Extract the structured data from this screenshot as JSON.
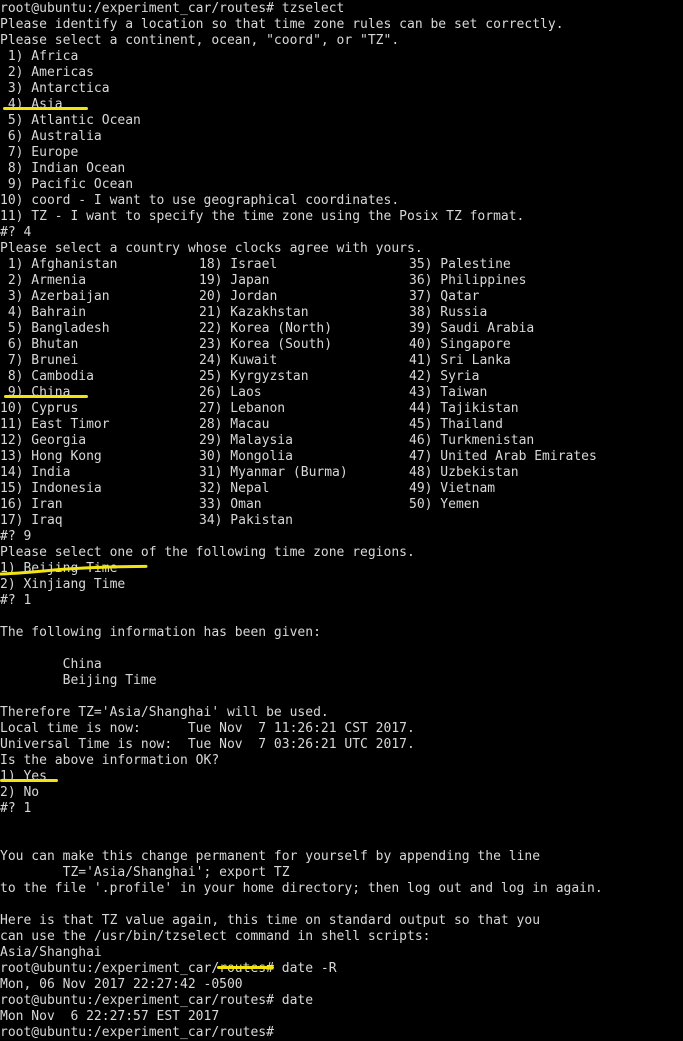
{
  "terminal": {
    "background_color": "#000000",
    "text_color": "#d8d8d8",
    "annotation_color": "#f2e313",
    "prompt": "root@ubuntu:/experiment_car/routes#",
    "command": "tzselect"
  },
  "lines": {
    "l01": "root@ubuntu:/experiment_car/routes# tzselect",
    "l02": "Please identify a location so that time zone rules can be set correctly.",
    "l03": "Please select a continent, ocean, \"coord\", or \"TZ\".",
    "l04": " 1) Africa",
    "l05": " 2) Americas",
    "l06": " 3) Antarctica",
    "l07": " 4) Asia",
    "l08": " 5) Atlantic Ocean",
    "l09": " 6) Australia",
    "l10": " 7) Europe",
    "l11": " 8) Indian Ocean",
    "l12": " 9) Pacific Ocean",
    "l13": "10) coord - I want to use geographical coordinates.",
    "l14": "11) TZ - I want to specify the time zone using the Posix TZ format.",
    "l15": "#? 4",
    "l16": "Please select a country whose clocks agree with yours.",
    "l17": "#? 9",
    "l18": "Please select one of the following time zone regions.",
    "l19": "1) Beijing Time",
    "l20": "2) Xinjiang Time",
    "l21": "#? 1",
    "l22": "",
    "l23": "The following information has been given:",
    "l24": "",
    "l25": "        China",
    "l26": "        Beijing Time",
    "l27": "",
    "l28": "Therefore TZ='Asia/Shanghai' will be used.",
    "l29": "Local time is now:      Tue Nov  7 11:26:21 CST 2017.",
    "l30": "Universal Time is now:  Tue Nov  7 03:26:21 UTC 2017.",
    "l31": "Is the above information OK?",
    "l32": "1) Yes",
    "l33": "2) No",
    "l34": "#? 1",
    "l35": "",
    "l36": "",
    "l37": "You can make this change permanent for yourself by appending the line",
    "l38": "        TZ='Asia/Shanghai'; export TZ",
    "l39": "to the file '.profile' in your home directory; then log out and log in again.",
    "l40": "",
    "l41": "Here is that TZ value again, this time on standard output so that you",
    "l42": "can use the /usr/bin/tzselect command in shell scripts:",
    "l43": "Asia/Shanghai",
    "l44": "root@ubuntu:/experiment_car/routes# date -R",
    "l45": "Mon, 06 Nov 2017 22:27:42 -0500",
    "l46": "root@ubuntu:/experiment_car/routes# date",
    "l47": "Mon Nov  6 22:27:57 EST 2017",
    "l48": "root@ubuntu:/experiment_car/routes#"
  },
  "countries": {
    "row01": {
      "c1": " 1) Afghanistan",
      "c2": "18) Israel",
      "c3": "35) Palestine"
    },
    "row02": {
      "c1": " 2) Armenia",
      "c2": "19) Japan",
      "c3": "36) Philippines"
    },
    "row03": {
      "c1": " 3) Azerbaijan",
      "c2": "20) Jordan",
      "c3": "37) Qatar"
    },
    "row04": {
      "c1": " 4) Bahrain",
      "c2": "21) Kazakhstan",
      "c3": "38) Russia"
    },
    "row05": {
      "c1": " 5) Bangladesh",
      "c2": "22) Korea (North)",
      "c3": "39) Saudi Arabia"
    },
    "row06": {
      "c1": " 6) Bhutan",
      "c2": "23) Korea (South)",
      "c3": "40) Singapore"
    },
    "row07": {
      "c1": " 7) Brunei",
      "c2": "24) Kuwait",
      "c3": "41) Sri Lanka"
    },
    "row08": {
      "c1": " 8) Cambodia",
      "c2": "25) Kyrgyzstan",
      "c3": "42) Syria"
    },
    "row09": {
      "c1": " 9) China",
      "c2": "26) Laos",
      "c3": "43) Taiwan"
    },
    "row10": {
      "c1": "10) Cyprus",
      "c2": "27) Lebanon",
      "c3": "44) Tajikistan"
    },
    "row11": {
      "c1": "11) East Timor",
      "c2": "28) Macau",
      "c3": "45) Thailand"
    },
    "row12": {
      "c1": "12) Georgia",
      "c2": "29) Malaysia",
      "c3": "46) Turkmenistan"
    },
    "row13": {
      "c1": "13) Hong Kong",
      "c2": "30) Mongolia",
      "c3": "47) United Arab Emirates"
    },
    "row14": {
      "c1": "14) India",
      "c2": "31) Myanmar (Burma)",
      "c3": "48) Uzbekistan"
    },
    "row15": {
      "c1": "15) Indonesia",
      "c2": "32) Nepal",
      "c3": "49) Vietnam"
    },
    "row16": {
      "c1": "16) Iran",
      "c2": "33) Oman",
      "c3": "50) Yemen"
    },
    "row17": {
      "c1": "17) Iraq",
      "c2": "34) Pakistan",
      "c3": ""
    }
  },
  "annotations": {
    "asia": {
      "target": "4) Asia",
      "color": "#f2e313"
    },
    "china": {
      "target": "9) China",
      "color": "#f2e313"
    },
    "beijing": {
      "target": "1) Beijing Time",
      "color": "#f2e313"
    },
    "yes": {
      "target": "1) Yes",
      "color": "#f2e313"
    },
    "offset": {
      "target": "-0500",
      "color": "#f2e313"
    }
  }
}
